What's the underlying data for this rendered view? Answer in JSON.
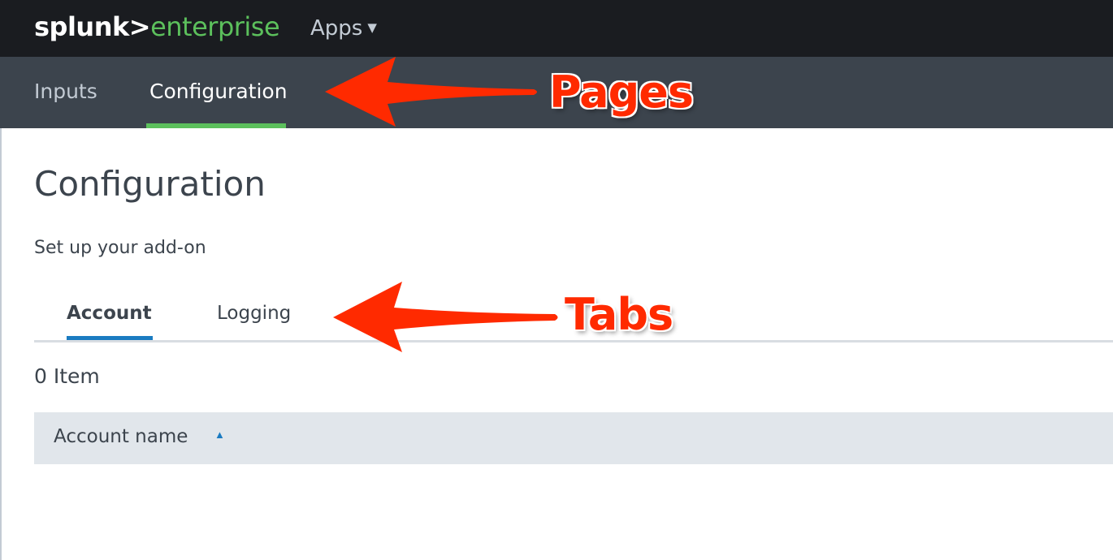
{
  "header": {
    "logo_brand": "splunk>",
    "logo_product": "enterprise",
    "apps_label": "Apps"
  },
  "nav": {
    "pages": [
      {
        "label": "Inputs",
        "active": false
      },
      {
        "label": "Configuration",
        "active": true
      }
    ]
  },
  "main": {
    "title": "Configuration",
    "subtitle": "Set up your add-on",
    "tabs": [
      {
        "label": "Account",
        "active": true
      },
      {
        "label": "Logging",
        "active": false
      }
    ],
    "item_count": "0 Item",
    "table": {
      "columns": [
        {
          "label": "Account name",
          "sort": "ascending"
        }
      ],
      "rows": []
    }
  },
  "annotations": {
    "pages_label": "Pages",
    "tabs_label": "Tabs",
    "color": "#ff2a00"
  },
  "colors": {
    "brand_green": "#5cc05c",
    "accent_blue": "#1a7bc1",
    "topbar": "#1a1c20",
    "navbar": "#3c444d"
  }
}
